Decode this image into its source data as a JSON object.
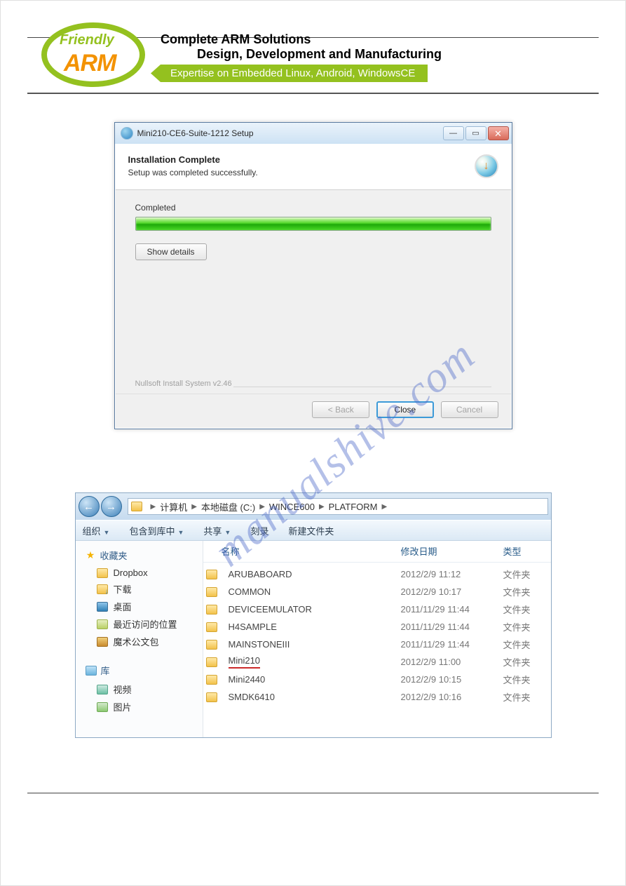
{
  "header": {
    "logo_top": "Friendly",
    "logo_bottom": "ARM",
    "line1": "Complete ARM Solutions",
    "line2": "Design, Development and  Manufacturing",
    "band": "Expertise on Embedded Linux, Android, WindowsCE"
  },
  "installer": {
    "window_title": "Mini210-CE6-Suite-1212 Setup",
    "heading": "Installation Complete",
    "sub": "Setup was completed successfully.",
    "status": "Completed",
    "show_details": "Show details",
    "footer_label": "Nullsoft Install System v2.46",
    "back": "< Back",
    "close": "Close",
    "cancel": "Cancel"
  },
  "explorer": {
    "crumb": {
      "c1": "计算机",
      "c2": "本地磁盘 (C:)",
      "c3": "WINCE600",
      "c4": "PLATFORM"
    },
    "toolbar": {
      "org": "组织",
      "include": "包含到库中",
      "share": "共享",
      "burn": "刻录",
      "newfolder": "新建文件夹"
    },
    "sidebar": {
      "fav": "收藏夹",
      "dropbox": "Dropbox",
      "download": "下载",
      "desktop": "桌面",
      "recent": "最近访问的位置",
      "briefcase": "魔术公文包",
      "lib": "库",
      "video": "视频",
      "image": "图片"
    },
    "columns": {
      "name": "名称",
      "date": "修改日期",
      "type": "类型"
    },
    "rows": [
      {
        "name": "ARUBABOARD",
        "date": "2012/2/9 11:12",
        "type": "文件夹"
      },
      {
        "name": "COMMON",
        "date": "2012/2/9 10:17",
        "type": "文件夹"
      },
      {
        "name": "DEVICEEMULATOR",
        "date": "2011/11/29 11:44",
        "type": "文件夹"
      },
      {
        "name": "H4SAMPLE",
        "date": "2011/11/29 11:44",
        "type": "文件夹"
      },
      {
        "name": "MAINSTONEIII",
        "date": "2011/11/29 11:44",
        "type": "文件夹"
      },
      {
        "name": "Mini210",
        "date": "2012/2/9 11:00",
        "type": "文件夹"
      },
      {
        "name": "Mini2440",
        "date": "2012/2/9 10:15",
        "type": "文件夹"
      },
      {
        "name": "SMDK6410",
        "date": "2012/2/9 10:16",
        "type": "文件夹"
      }
    ]
  },
  "watermark": "manualshive.com"
}
